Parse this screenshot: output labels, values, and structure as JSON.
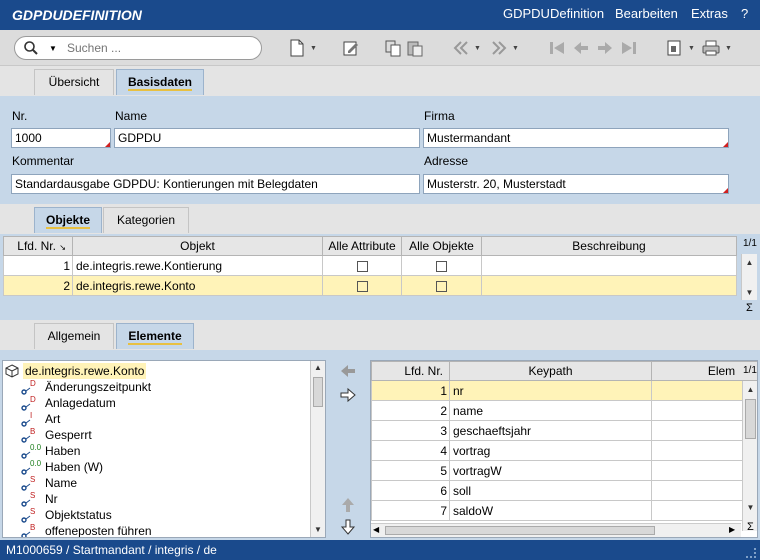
{
  "app": {
    "title": "GDPDUDEFINITION",
    "menu": {
      "item1": "GDPDUDefinition",
      "item2": "Bearbeiten",
      "item3": "Extras",
      "help": "?"
    }
  },
  "toolbar": {
    "search_placeholder": "Suchen ...",
    "icons": [
      "search-icon",
      "new-doc-icon",
      "edit-icon",
      "copy-icon",
      "paste-icon",
      "back-icon",
      "forward-icon",
      "first-icon",
      "prev-icon",
      "next-icon",
      "last-icon",
      "view-icon",
      "print-icon"
    ]
  },
  "main_tabs": [
    "Übersicht",
    "Basisdaten"
  ],
  "form": {
    "nr_label": "Nr.",
    "nr_value": "1000",
    "name_label": "Name",
    "name_value": "GDPDU",
    "firma_label": "Firma",
    "firma_value": "Mustermandant",
    "kommentar_label": "Kommentar",
    "kommentar_value": "Standardausgabe GDPDU: Kontierungen mit Belegdaten",
    "adresse_label": "Adresse",
    "adresse_value": "Musterstr. 20, Musterstadt"
  },
  "section_tabs": [
    "Objekte",
    "Kategorien"
  ],
  "objects_table": {
    "headers": [
      "Lfd. Nr.",
      "Objekt",
      "Alle Attribute",
      "Alle Objekte",
      "Beschreibung"
    ],
    "page": "1/1",
    "sigma": "Σ",
    "rows": [
      {
        "nr": "1",
        "objekt": "de.integris.rewe.Kontierung",
        "alle_attribute": false,
        "alle_objekte": false,
        "beschreibung": ""
      },
      {
        "nr": "2",
        "objekt": "de.integris.rewe.Konto",
        "alle_attribute": false,
        "alle_objekte": false,
        "beschreibung": ""
      }
    ]
  },
  "lower_tabs": [
    "Allgemein",
    "Elemente"
  ],
  "tree": {
    "root": "de.integris.rewe.Konto",
    "items": [
      {
        "label": "Änderungszeitpunkt",
        "type": "D"
      },
      {
        "label": "Anlagedatum",
        "type": "D"
      },
      {
        "label": "Art",
        "type": "I"
      },
      {
        "label": "Gesperrt",
        "type": "B"
      },
      {
        "label": "Haben",
        "type": "0.0"
      },
      {
        "label": "Haben (W)",
        "type": "0.0"
      },
      {
        "label": "Name",
        "type": "S"
      },
      {
        "label": "Nr",
        "type": "S"
      },
      {
        "label": "Objektstatus",
        "type": "S"
      },
      {
        "label": "offeneposten führen",
        "type": "B"
      }
    ]
  },
  "elements_table": {
    "headers": [
      "Lfd. Nr.",
      "Keypath",
      "Elem"
    ],
    "page": "1/1",
    "sigma": "Σ",
    "rows": [
      {
        "nr": "1",
        "keypath": "nr"
      },
      {
        "nr": "2",
        "keypath": "name"
      },
      {
        "nr": "3",
        "keypath": "geschaeftsjahr"
      },
      {
        "nr": "4",
        "keypath": "vortrag"
      },
      {
        "nr": "5",
        "keypath": "vortragW"
      },
      {
        "nr": "6",
        "keypath": "soll"
      },
      {
        "nr": "7",
        "keypath": "saldoW"
      }
    ]
  },
  "statusbar": {
    "text": "M1000659 / Startmandant / integris / de"
  },
  "colors": {
    "title_bg": "#1a4a8c",
    "panel_bg": "#c6d7e8",
    "selection": "#fff3b8",
    "active_tab_underline": "#e8c040",
    "required_marker": "#d02020"
  }
}
